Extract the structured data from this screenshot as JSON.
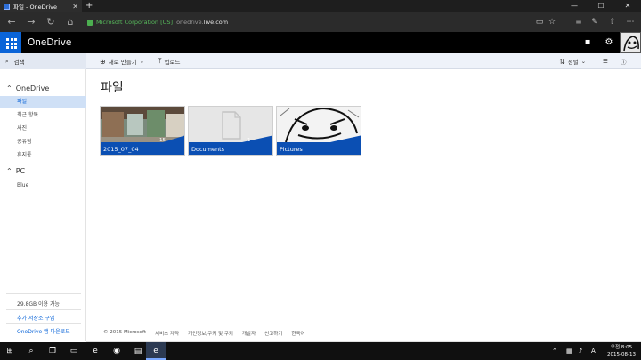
{
  "browser": {
    "tab_title": "파일 - OneDrive",
    "tab_close": "✕",
    "new_tab": "+",
    "window_controls": [
      "—",
      "☐",
      "✕"
    ],
    "cert_name": "Microsoft Corporation [US]",
    "url_prefix": "onedrive.",
    "url_domain": "live.com",
    "toolbar_icons": [
      "reading-view-icon",
      "favorite-star-icon",
      "hub-icon",
      "web-note-icon",
      "share-icon",
      "more-icon"
    ]
  },
  "app": {
    "brand": "OneDrive",
    "accent": "#0a64d8",
    "band_color": "#0b4fb3"
  },
  "commandbar": {
    "search": "검색",
    "new": "새로 만들기",
    "upload": "업로드",
    "sort": "정렬"
  },
  "nav": {
    "onedrive_header": "OneDrive",
    "items": [
      {
        "label": "파일",
        "active": true
      },
      {
        "label": "최근 항목",
        "active": false
      },
      {
        "label": "사진",
        "active": false
      },
      {
        "label": "공유됨",
        "active": false
      },
      {
        "label": "휴지통",
        "active": false
      }
    ],
    "pc_header": "PC",
    "pc_items": [
      {
        "label": "Blue"
      }
    ],
    "quota": "29.8GB 이용 가능",
    "buy_storage": "추가 저장소 구입",
    "get_app": "OneDrive 앱 다운로드"
  },
  "main": {
    "title": "파일",
    "tiles": [
      {
        "name": "2015_07_04",
        "count": "15"
      },
      {
        "name": "Documents",
        "count": "1"
      },
      {
        "name": "Pictures",
        "count": "7"
      }
    ]
  },
  "footer": {
    "links": [
      "© 2015 Microsoft",
      "서비스 계약",
      "개인정보/쿠키 및 쿠키",
      "개발자",
      "신고하기",
      "한국어"
    ]
  },
  "taskbar": {
    "time": "오전 8:05",
    "date": "2015-08-13",
    "lang": "A"
  }
}
